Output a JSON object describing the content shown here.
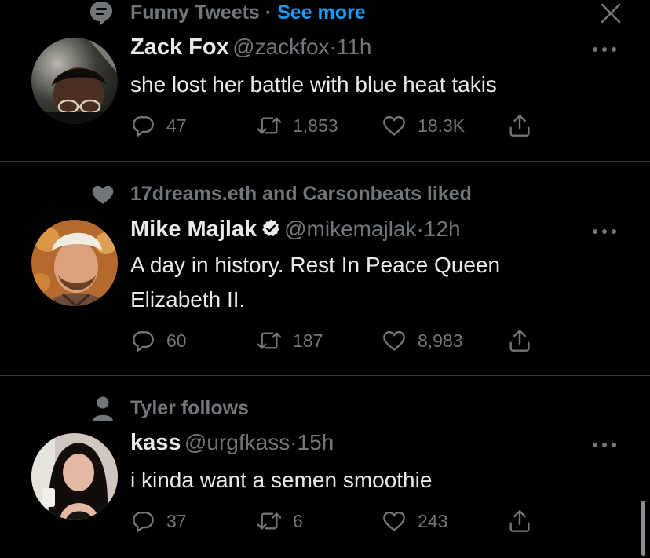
{
  "header": {
    "topic": "Funny Tweets",
    "separator": "·",
    "see_more": "See more"
  },
  "tweets": [
    {
      "context": "",
      "name": "Zack Fox",
      "handle": "@zackfox",
      "dot": "·",
      "time": "11h",
      "text": "she lost her battle with blue heat takis",
      "replies": "47",
      "retweets": "1,853",
      "likes": "18.3K"
    },
    {
      "context": "17dreams.eth and Carsonbeats liked",
      "name": "Mike Majlak",
      "handle": "@mikemajlak",
      "dot": "·",
      "time": "12h",
      "text_line1": "A day in history. Rest In Peace Queen",
      "text_line2": "Elizabeth II.",
      "replies": "60",
      "retweets": "187",
      "likes": "8,983"
    },
    {
      "context": "Tyler follows",
      "name": "kass",
      "handle": "@urgfkass",
      "dot": "·",
      "time": "15h",
      "text": "i kinda want a semen smoothie",
      "replies": "37",
      "retweets": "6",
      "likes": "243"
    }
  ],
  "colors": {
    "background": "#000000",
    "text_primary": "#e7e9ea",
    "text_secondary": "#71767b",
    "accent": "#1d9bf0",
    "divider": "#2f3336"
  },
  "icons": {
    "topic": "topic-icon",
    "heart": "heart-icon",
    "person": "person-icon",
    "verified": "verified-badge-icon",
    "reply": "reply-icon",
    "retweet": "retweet-icon",
    "like": "like-icon",
    "share": "share-icon",
    "more": "more-icon",
    "close": "close-icon"
  }
}
